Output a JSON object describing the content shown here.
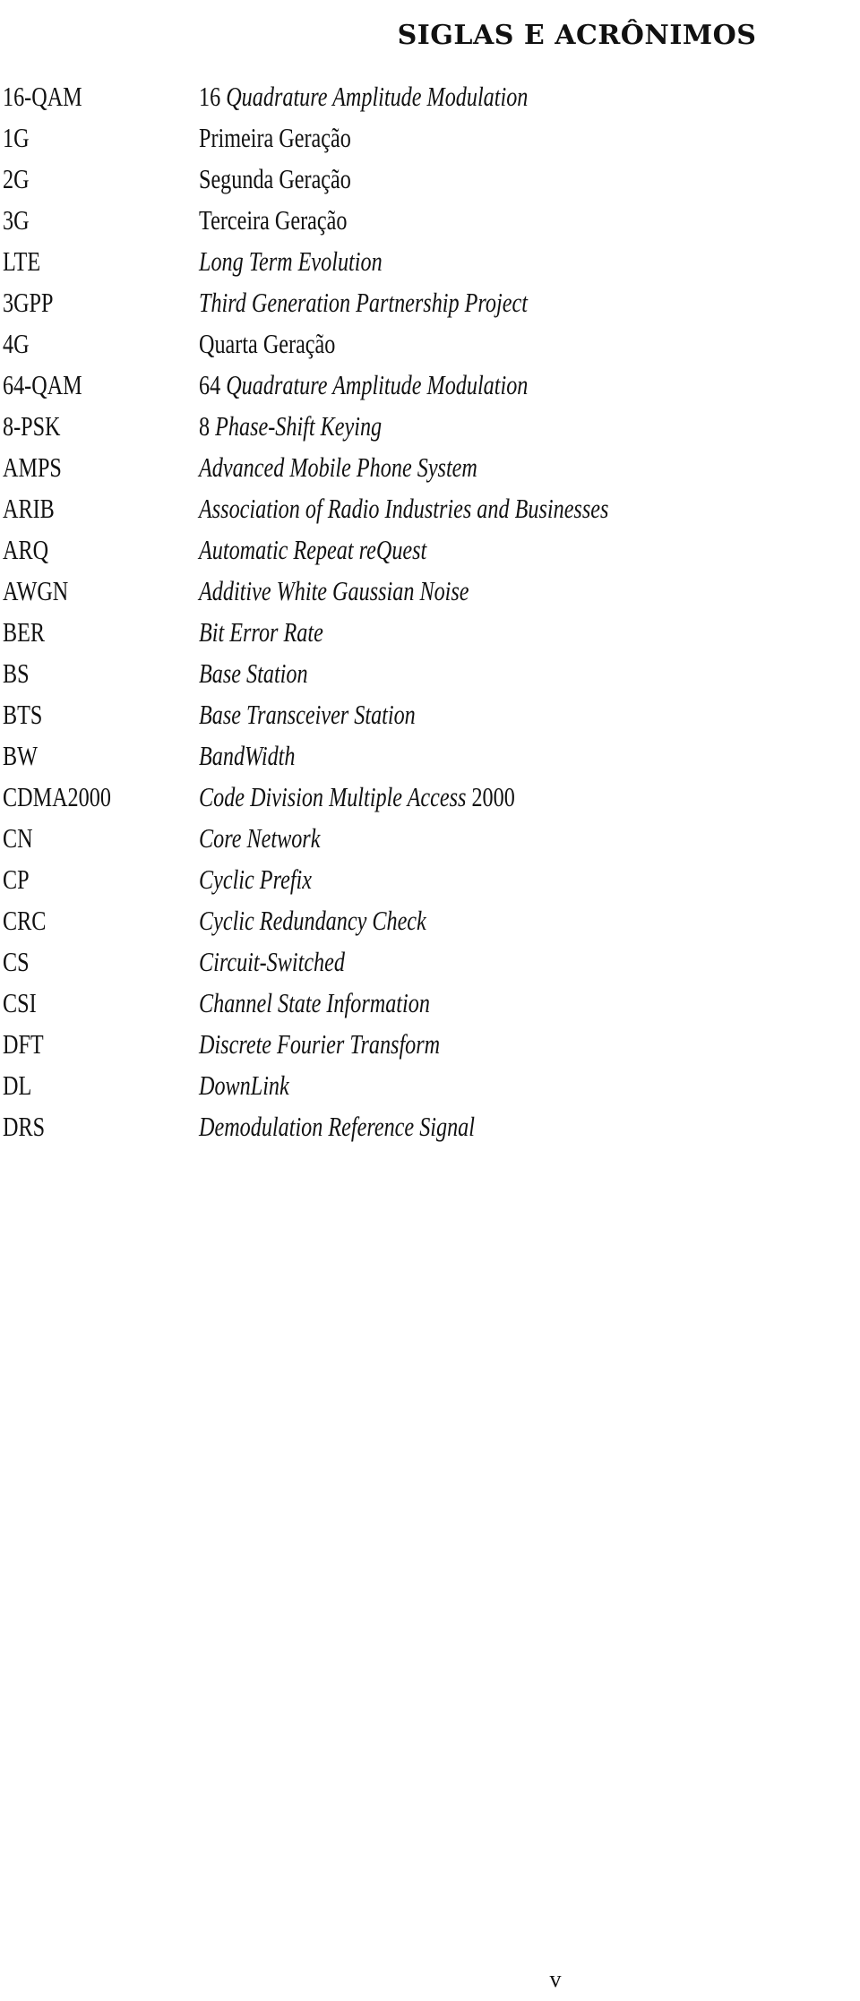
{
  "page": {
    "title": "SIGLAS E ACRÔNIMOS",
    "page_number": "v"
  },
  "acronyms": [
    {
      "abbr": "16-QAM",
      "parts": [
        {
          "text": "16 ",
          "italic": false
        },
        {
          "text": "Quadrature Amplitude Modulation",
          "italic": true
        }
      ]
    },
    {
      "abbr": "1G",
      "parts": [
        {
          "text": "Primeira Geração",
          "italic": false
        }
      ]
    },
    {
      "abbr": "2G",
      "parts": [
        {
          "text": "Segunda Geração",
          "italic": false
        }
      ]
    },
    {
      "abbr": "3G",
      "parts": [
        {
          "text": "Terceira Geração",
          "italic": false
        }
      ]
    },
    {
      "abbr": "LTE",
      "parts": [
        {
          "text": "Long Term Evolution",
          "italic": true
        }
      ]
    },
    {
      "abbr": "3GPP",
      "parts": [
        {
          "text": "Third Generation Partnership Project",
          "italic": true
        }
      ]
    },
    {
      "abbr": "4G",
      "parts": [
        {
          "text": "Quarta Geração",
          "italic": false
        }
      ]
    },
    {
      "abbr": "64-QAM",
      "parts": [
        {
          "text": "64 ",
          "italic": false
        },
        {
          "text": "Quadrature Amplitude Modulation",
          "italic": true
        }
      ]
    },
    {
      "abbr": "8-PSK",
      "parts": [
        {
          "text": "8 ",
          "italic": false
        },
        {
          "text": "Phase-Shift Keying",
          "italic": true
        }
      ]
    },
    {
      "abbr": "AMPS",
      "parts": [
        {
          "text": "Advanced Mobile Phone System",
          "italic": true
        }
      ]
    },
    {
      "abbr": "ARIB",
      "parts": [
        {
          "text": "Association of Radio Industries and Businesses",
          "italic": true
        }
      ]
    },
    {
      "abbr": "ARQ",
      "parts": [
        {
          "text": "Automatic Repeat reQuest",
          "italic": true
        }
      ]
    },
    {
      "abbr": "AWGN",
      "parts": [
        {
          "text": "Additive White Gaussian Noise",
          "italic": true
        }
      ]
    },
    {
      "abbr": "BER",
      "parts": [
        {
          "text": "Bit Error Rate",
          "italic": true
        }
      ]
    },
    {
      "abbr": "BS",
      "parts": [
        {
          "text": "Base Station",
          "italic": true
        }
      ]
    },
    {
      "abbr": "BTS",
      "parts": [
        {
          "text": "Base Transceiver Station",
          "italic": true
        }
      ]
    },
    {
      "abbr": "BW",
      "parts": [
        {
          "text": "BandWidth",
          "italic": true
        }
      ]
    },
    {
      "abbr": "CDMA2000",
      "parts": [
        {
          "text": "Code Division Multiple Access",
          "italic": true
        },
        {
          "text": " 2000",
          "italic": false
        }
      ]
    },
    {
      "abbr": "CN",
      "parts": [
        {
          "text": "Core Network",
          "italic": true
        }
      ]
    },
    {
      "abbr": "CP",
      "parts": [
        {
          "text": "Cyclic Prefix",
          "italic": true
        }
      ]
    },
    {
      "abbr": "CRC",
      "parts": [
        {
          "text": "Cyclic Redundancy Check",
          "italic": true
        }
      ]
    },
    {
      "abbr": "CS",
      "parts": [
        {
          "text": "Circuit-Switched",
          "italic": true
        }
      ]
    },
    {
      "abbr": "CSI",
      "parts": [
        {
          "text": "Channel State Information",
          "italic": true
        }
      ]
    },
    {
      "abbr": "DFT",
      "parts": [
        {
          "text": "Discrete Fourier Transform",
          "italic": true
        }
      ]
    },
    {
      "abbr": "DL",
      "parts": [
        {
          "text": "DownLink",
          "italic": true
        }
      ]
    },
    {
      "abbr": "DRS",
      "parts": [
        {
          "text": "Demodulation Reference Signal",
          "italic": true
        }
      ]
    }
  ]
}
